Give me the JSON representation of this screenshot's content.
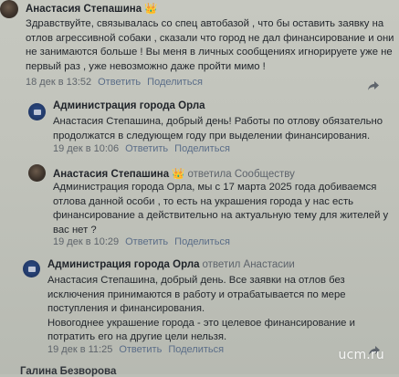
{
  "comments": [
    {
      "author": "Анастасия Степашина",
      "crown": "👑",
      "reply_note": "",
      "lines": [
        "Здравствуйте, связывалась со спец автобазой , что бы оставить заявку на",
        "отлов агрессивной собаки , сказали что город не дал финансирование и они",
        "не занимаются больше ! Вы меня в личных сообщениях игнорируете уже не",
        "первый раз , уже невозможно даже пройти мимо !"
      ],
      "time": "18 дек в 13:52",
      "reply_label": "Ответить",
      "share_label": "Поделиться"
    },
    {
      "author": "Администрация города Орла",
      "crown": "",
      "reply_note": "",
      "lines": [
        "Анастасия Степашина, добрый день! Работы по отлову обязательно",
        "продолжатся в следующем году при выделении финансирования."
      ],
      "time": "19 дек в 10:06",
      "reply_label": "Ответить",
      "share_label": "Поделиться"
    },
    {
      "author": "Анастасия Степашина",
      "crown": "👑",
      "reply_note": "ответила Сообществу",
      "lines": [
        "Администрация города Орла, мы с 17 марта 2025 года добиваемся",
        "отлова данной особи , то есть на украшения города у нас есть",
        "финансирование а действительно на актуальную тему для жителей у",
        "вас нет ?"
      ],
      "time": "19 дек в 10:29",
      "reply_label": "Ответить",
      "share_label": "Поделиться"
    },
    {
      "author": "Администрация города Орла",
      "crown": "",
      "reply_note": "ответил Анастасии",
      "lines": [
        "Анастасия Степашина, добрый день. Все заявки на отлов без",
        "исключения принимаются в работу и отрабатывается по мере",
        "поступления и финансирования.",
        "Новогоднее украшение города - это целевое финансирование и",
        "потратить его на другие цели нельзя."
      ],
      "time": "19 дек в 11:25",
      "reply_label": "Ответить",
      "share_label": "Поделиться"
    }
  ],
  "next_author": "Галина Безворова",
  "watermark": "ucm.ru"
}
